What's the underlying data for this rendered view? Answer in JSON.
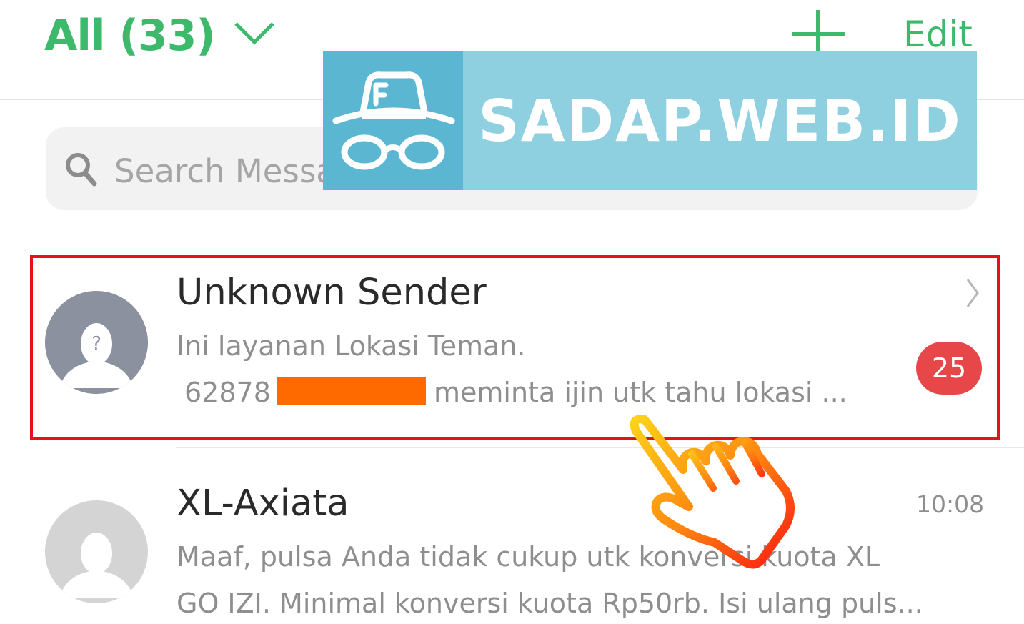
{
  "header": {
    "filter_label": "All (33)",
    "edit_label": "Edit"
  },
  "search": {
    "placeholder": "Search Messages"
  },
  "watermark": {
    "text": "SADAP.WEB.ID"
  },
  "messages": [
    {
      "sender": "Unknown Sender",
      "preview_line1": "Ini layanan Lokasi Teman.",
      "number_prefix": "62878",
      "preview_line2_suffix": "meminta ijin utk tahu lokasi ...",
      "unread_count": "25",
      "avatar_glyph": "?",
      "highlighted": true
    },
    {
      "sender": "XL-Axiata",
      "time": "10:08",
      "preview_line1": "Maaf, pulsa Anda tidak cukup utk konversi kuota XL",
      "preview_line2": "GO IZI. Minimal konversi kuota Rp50rb. Isi ulang puls..."
    }
  ],
  "icons": {
    "filter_dropdown": "chevron-down-icon",
    "add": "plus-icon",
    "search": "search-icon",
    "watermark_logo": "incognito-icon",
    "row_arrow": "chevron-right-icon",
    "pointer": "tap-hand-icon"
  },
  "colors": {
    "accent_green": "#3cb96a",
    "badge_red": "#e8474a",
    "highlight_red": "#e8101c",
    "redaction_orange": "#ff6a00",
    "watermark_blue": "#8ecfe0"
  }
}
